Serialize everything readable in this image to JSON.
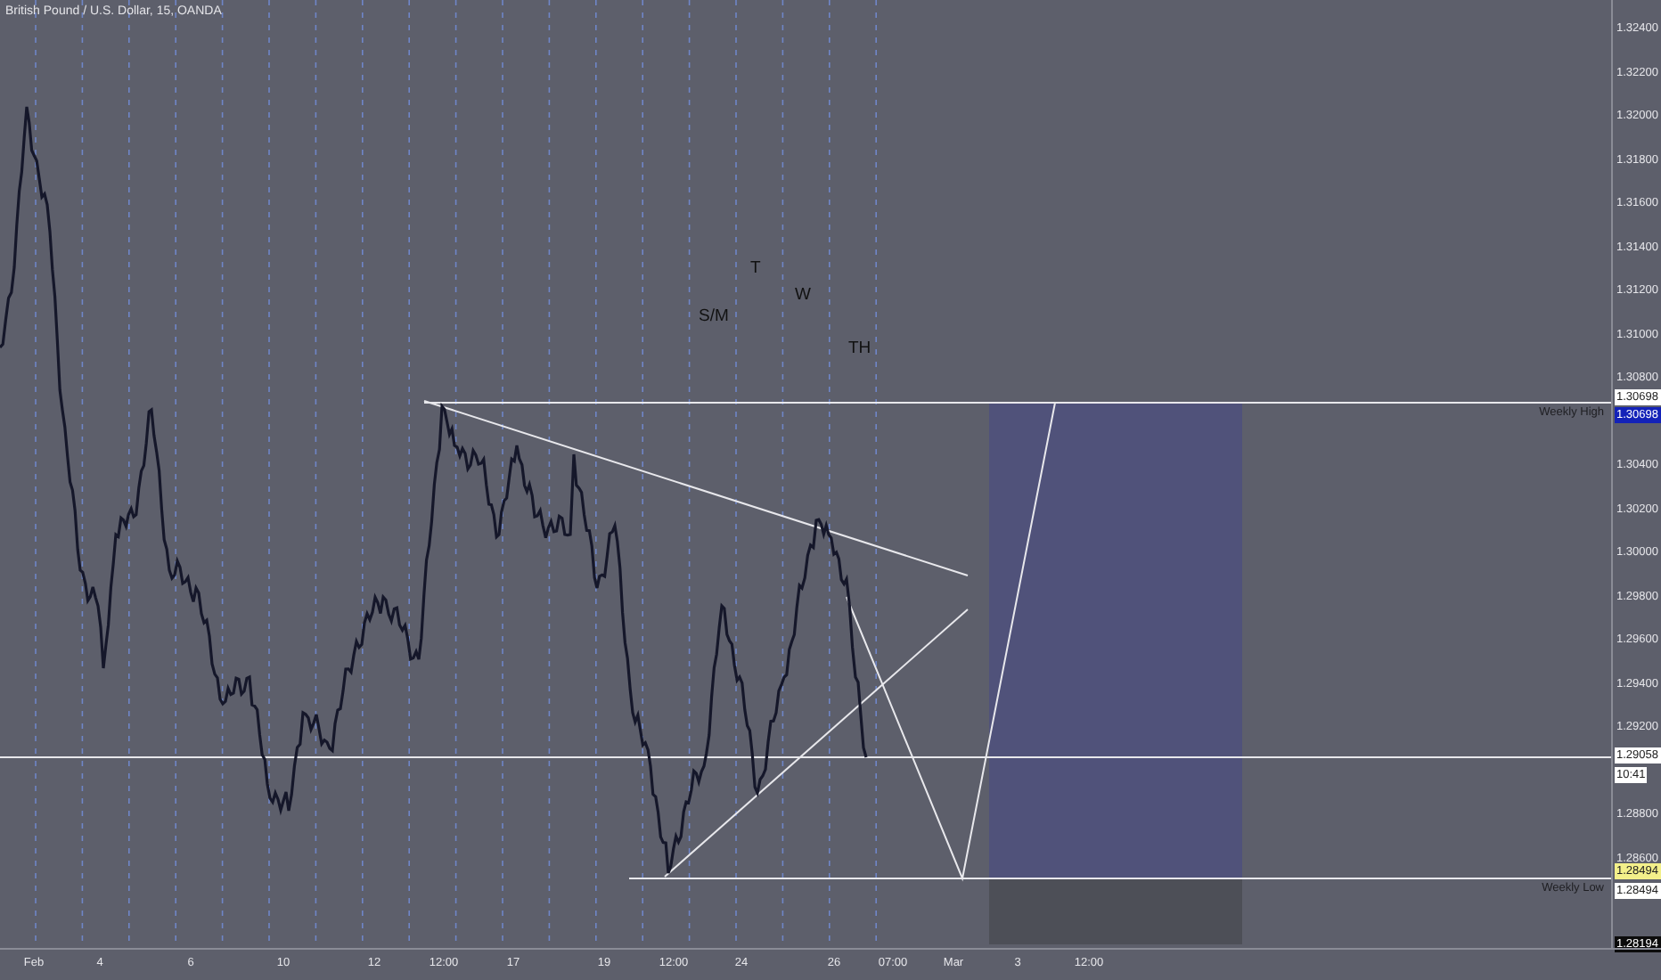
{
  "chart": {
    "title": "British Pound / U.S. Dollar, 15, OANDA",
    "annotations": [
      "S/M",
      "T",
      "W",
      "TH"
    ],
    "line_labels": [
      "Weekly High",
      "Weekly Low"
    ]
  },
  "price_axis": {
    "ticks": [
      "1.32400",
      "1.32200",
      "1.32000",
      "1.31800",
      "1.31600",
      "1.31400",
      "1.31200",
      "1.31000",
      "1.30800",
      "1.30400",
      "1.30200",
      "1.30000",
      "1.29800",
      "1.29600",
      "1.29400",
      "1.29200",
      "1.28800",
      "1.28600"
    ],
    "tags": [
      {
        "text": "1.30698",
        "kind": "line"
      },
      {
        "text": "1.30698",
        "kind": "high"
      },
      {
        "text": "1.29058",
        "kind": "line"
      },
      {
        "text": "10:41",
        "kind": "countdown"
      },
      {
        "text": "1.28494",
        "kind": "highlight"
      },
      {
        "text": "1.28494",
        "kind": "line"
      },
      {
        "text": "1.28194",
        "kind": "low"
      }
    ]
  },
  "time_axis": {
    "labels": [
      "Feb",
      "4",
      "6",
      "10",
      "12",
      "12:00",
      "17",
      "19",
      "12:00",
      "24",
      "26",
      "07:00",
      "Mar",
      "3",
      "12:00"
    ]
  }
}
